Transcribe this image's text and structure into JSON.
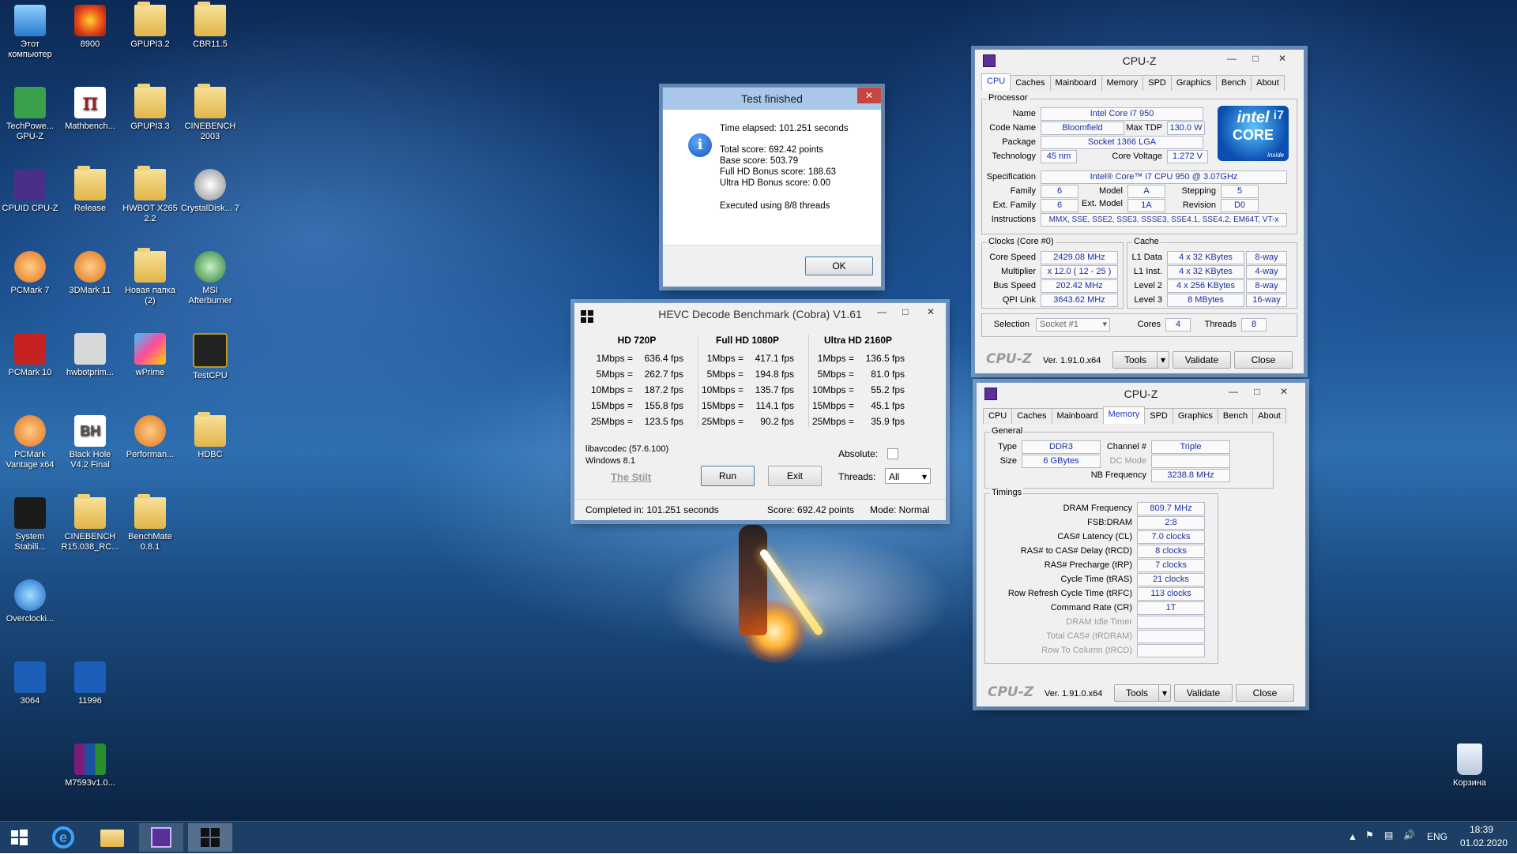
{
  "desktop": {
    "icons": [
      {
        "label": "Этот компьютер",
        "img": "pc",
        "icon": "computer-icon"
      },
      {
        "label": "TechPowe... GPU-Z",
        "img": "green",
        "icon": "gpuz-icon"
      },
      {
        "label": "CPUID CPU-Z",
        "img": "purple",
        "icon": "cpuz-icon"
      },
      {
        "label": "PCMark 7",
        "img": "orange",
        "icon": "pcmark-icon"
      },
      {
        "label": "PCMark 10",
        "img": "red",
        "icon": "pcmark10-icon"
      },
      {
        "label": "PCMark Vantage x64",
        "img": "orange",
        "icon": "pcmark-vantage-icon"
      },
      {
        "label": "System Stabili...",
        "img": "dark",
        "icon": "system-stability-icon"
      },
      {
        "label": "Overclocki...",
        "img": "globe",
        "icon": "overclocking-icon"
      },
      {
        "label": "3064",
        "img": "blue",
        "icon": "image-file-icon"
      },
      {
        "label": "8900",
        "img": "flower",
        "icon": "image-file-icon"
      },
      {
        "label": "Mathbench...",
        "img": "pi",
        "icon": "mathbench-icon"
      },
      {
        "label": "Release",
        "img": "folder",
        "icon": "folder-icon"
      },
      {
        "label": "3DMark 11",
        "img": "orange",
        "icon": "3dmark-icon"
      },
      {
        "label": "hwbotprim...",
        "img": "grey",
        "icon": "file-icon"
      },
      {
        "label": "Black Hole V4.2 Final",
        "img": "bh",
        "icon": "blackhole-icon"
      },
      {
        "label": "CINEBENCH R15.038_RC...",
        "img": "folder",
        "icon": "folder-icon"
      },
      {
        "label": "11996",
        "img": "blue",
        "icon": "image-file-icon"
      },
      {
        "label": "M7593v1.0...",
        "img": "rar",
        "icon": "archive-icon"
      },
      {
        "label": "GPUPI3.2",
        "img": "folder",
        "icon": "folder-icon"
      },
      {
        "label": "GPUPI3.3",
        "img": "folder",
        "icon": "folder-icon"
      },
      {
        "label": "HWBOT X265 2.2",
        "img": "folder",
        "icon": "folder-icon"
      },
      {
        "label": "Новая папка (2)",
        "img": "folder",
        "icon": "folder-icon"
      },
      {
        "label": "wPrime",
        "img": "wprime",
        "icon": "wprime-icon"
      },
      {
        "label": "Performan...",
        "img": "orange",
        "icon": "performance-icon"
      },
      {
        "label": "BenchMate 0.8.1",
        "img": "folder",
        "icon": "folder-icon"
      },
      {
        "label": "CBR11.5",
        "img": "folder",
        "icon": "folder-icon"
      },
      {
        "label": "CINEBENCH 2003",
        "img": "folder",
        "icon": "folder-icon"
      },
      {
        "label": "CrystalDisk... 7",
        "img": "disk",
        "icon": "crystaldisk-icon"
      },
      {
        "label": "MSI Afterburner",
        "img": "afterb",
        "icon": "afterburner-icon"
      },
      {
        "label": "TestCPU",
        "img": "chip",
        "icon": "chip-icon"
      },
      {
        "label": "HDBC",
        "img": "folder",
        "icon": "folder-icon"
      }
    ],
    "recycle_bin": "Корзина"
  },
  "dialog": {
    "title": "Test finished",
    "time_elapsed": "Time elapsed:  101.251 seconds",
    "total_score": "Total score:  692.42 points",
    "base_score": "Base score: 503.79",
    "fullhd_bonus": "Full HD Bonus score: 188.63",
    "ultrahd_bonus": "Ultra HD Bonus score: 0.00",
    "threads_used": "Executed using 8/8 threads",
    "ok": "OK"
  },
  "hevc": {
    "title": "HEVC Decode Benchmark (Cobra) V1.61",
    "columns": [
      {
        "header": "HD 720P",
        "rows": [
          [
            "1Mbps =",
            "636.4 fps"
          ],
          [
            "5Mbps =",
            "262.7 fps"
          ],
          [
            "10Mbps =",
            "187.2 fps"
          ],
          [
            "15Mbps =",
            "155.8 fps"
          ],
          [
            "25Mbps =",
            "123.5 fps"
          ]
        ]
      },
      {
        "header": "Full HD 1080P",
        "rows": [
          [
            "1Mbps =",
            "417.1 fps"
          ],
          [
            "5Mbps =",
            "194.8 fps"
          ],
          [
            "10Mbps =",
            "135.7 fps"
          ],
          [
            "15Mbps =",
            "114.1 fps"
          ],
          [
            "25Mbps =",
            "90.2 fps"
          ]
        ]
      },
      {
        "header": "Ultra HD 2160P",
        "rows": [
          [
            "1Mbps =",
            "136.5 fps"
          ],
          [
            "5Mbps =",
            "81.0 fps"
          ],
          [
            "10Mbps =",
            "55.2 fps"
          ],
          [
            "15Mbps =",
            "45.1 fps"
          ],
          [
            "25Mbps =",
            "35.9 fps"
          ]
        ]
      }
    ],
    "libavcodec": "libavcodec (57.6.100)",
    "os": "Windows 8.1",
    "author": "The Stilt",
    "absolute_label": "Absolute:",
    "run": "Run",
    "exit": "Exit",
    "threads_label": "Threads:",
    "threads_value": "All",
    "completed": "Completed in: 101.251 seconds",
    "score": "Score: 692.42 points",
    "mode": "Mode: Normal"
  },
  "cpuz_tabs": [
    "CPU",
    "Caches",
    "Mainboard",
    "Memory",
    "SPD",
    "Graphics",
    "Bench",
    "About"
  ],
  "cpuz1": {
    "title": "CPU-Z",
    "processor_legend": "Processor",
    "name_l": "Name",
    "name": "Intel Core i7 950",
    "codename_l": "Code Name",
    "codename": "Bloomfield",
    "tdp_l": "Max TDP",
    "tdp": "130.0 W",
    "package_l": "Package",
    "package": "Socket 1366 LGA",
    "tech_l": "Technology",
    "tech": "45 nm",
    "voltage_l": "Core Voltage",
    "voltage": "1.272 V",
    "spec_l": "Specification",
    "spec": "Intel® Core™ i7 CPU        950  @ 3.07GHz",
    "family_l": "Family",
    "family": "6",
    "model_l": "Model",
    "model": "A",
    "stepping_l": "Stepping",
    "stepping": "5",
    "extfamily_l": "Ext. Family",
    "extfamily": "6",
    "extmodel_l": "Ext. Model",
    "extmodel": "1A",
    "revision_l": "Revision",
    "revision": "D0",
    "instr_l": "Instructions",
    "instr": "MMX, SSE, SSE2, SSE3, SSSE3, SSE4.1, SSE4.2, EM64T, VT-x",
    "clocks_legend": "Clocks (Core #0)",
    "corespeed_l": "Core Speed",
    "corespeed": "2429.08 MHz",
    "multi_l": "Multiplier",
    "multi": "x 12.0 ( 12 - 25 )",
    "bus_l": "Bus Speed",
    "bus": "202.42 MHz",
    "qpi_l": "QPI Link",
    "qpi": "3643.62 MHz",
    "cache_legend": "Cache",
    "l1d_l": "L1 Data",
    "l1d": "4 x 32 KBytes",
    "l1d_w": "8-way",
    "l1i_l": "L1 Inst.",
    "l1i": "4 x 32 KBytes",
    "l1i_w": "4-way",
    "l2_l": "Level 2",
    "l2": "4 x 256 KBytes",
    "l2_w": "8-way",
    "l3_l": "Level 3",
    "l3": "8 MBytes",
    "l3_w": "16-way",
    "selection_l": "Selection",
    "selection": "Socket #1",
    "cores_l": "Cores",
    "cores": "4",
    "threads_l": "Threads",
    "threads": "8",
    "intel_brand": "intel",
    "intel_core": "CORE",
    "intel_i7": "i7",
    "intel_inside": "inside"
  },
  "cpuz2": {
    "title": "CPU-Z",
    "general_legend": "General",
    "type_l": "Type",
    "type": "DDR3",
    "size_l": "Size",
    "size": "6 GBytes",
    "channel_l": "Channel #",
    "channel": "Triple",
    "dcmode_l": "DC Mode",
    "nbfreq_l": "NB Frequency",
    "nbfreq": "3238.8 MHz",
    "timings_legend": "Timings",
    "timings": [
      [
        "DRAM Frequency",
        "809.7 MHz"
      ],
      [
        "FSB:DRAM",
        "2:8"
      ],
      [
        "CAS# Latency (CL)",
        "7.0 clocks"
      ],
      [
        "RAS# to CAS# Delay (tRCD)",
        "8 clocks"
      ],
      [
        "RAS# Precharge (tRP)",
        "7 clocks"
      ],
      [
        "Cycle Time (tRAS)",
        "21 clocks"
      ],
      [
        "Row Refresh Cycle Time (tRFC)",
        "113 clocks"
      ],
      [
        "Command Rate (CR)",
        "1T"
      ],
      [
        "DRAM Idle Timer",
        ""
      ],
      [
        "Total CAS# (tRDRAM)",
        ""
      ],
      [
        "Row To Column (tRCD)",
        ""
      ]
    ]
  },
  "cpuz_footer": {
    "logo": "CPU-Z",
    "version": "Ver. 1.91.0.x64",
    "tools": "Tools",
    "validate": "Validate",
    "close": "Close"
  },
  "taskbar": {
    "lang": "ENG",
    "time": "18:39",
    "date": "01.02.2020"
  }
}
